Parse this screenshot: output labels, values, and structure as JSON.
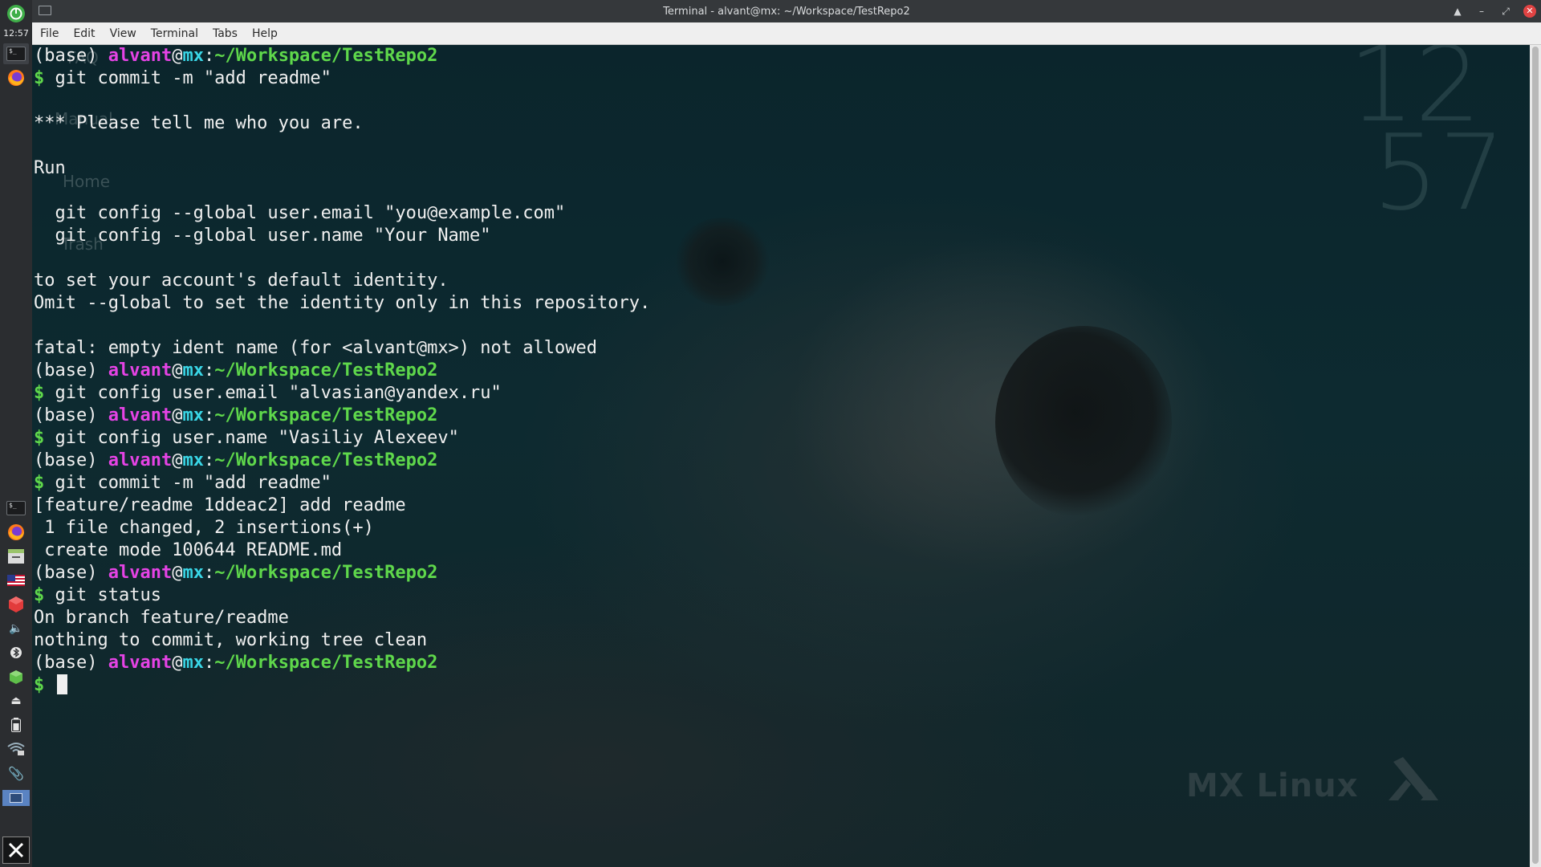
{
  "window": {
    "title": "Terminal - alvant@mx: ~/Workspace/TestRepo2"
  },
  "menubar": {
    "items": [
      "File",
      "Edit",
      "View",
      "Terminal",
      "Tabs",
      "Help"
    ]
  },
  "panel": {
    "clock": "12:57"
  },
  "desktop": {
    "clock_hours": "12",
    "clock_minutes": "57",
    "icon_labels": [
      "FAQ",
      "Manual",
      "Home",
      "Trash"
    ],
    "brand": "MX Linux"
  },
  "prompt": {
    "env": "(base)",
    "user": "alvant",
    "at": "@",
    "host": "mx",
    "colon": ":",
    "path": "~/Workspace/TestRepo2",
    "dollar": "$"
  },
  "terminal": {
    "lines": [
      {
        "type": "prompt"
      },
      {
        "type": "cmd",
        "text": "git commit -m \"add readme\""
      },
      {
        "type": "out",
        "text": ""
      },
      {
        "type": "out",
        "text": "*** Please tell me who you are."
      },
      {
        "type": "out",
        "text": ""
      },
      {
        "type": "out",
        "text": "Run"
      },
      {
        "type": "out",
        "text": ""
      },
      {
        "type": "out",
        "text": "  git config --global user.email \"you@example.com\""
      },
      {
        "type": "out",
        "text": "  git config --global user.name \"Your Name\""
      },
      {
        "type": "out",
        "text": ""
      },
      {
        "type": "out",
        "text": "to set your account's default identity."
      },
      {
        "type": "out",
        "text": "Omit --global to set the identity only in this repository."
      },
      {
        "type": "out",
        "text": ""
      },
      {
        "type": "out",
        "text": "fatal: empty ident name (for <alvant@mx>) not allowed"
      },
      {
        "type": "prompt"
      },
      {
        "type": "cmd",
        "text": "git config user.email \"alvasian@yandex.ru\""
      },
      {
        "type": "prompt"
      },
      {
        "type": "cmd",
        "text": "git config user.name \"Vasiliy Alexeev\""
      },
      {
        "type": "prompt"
      },
      {
        "type": "cmd",
        "text": "git commit -m \"add readme\""
      },
      {
        "type": "out",
        "text": "[feature/readme 1ddeac2] add readme"
      },
      {
        "type": "out",
        "text": " 1 file changed, 2 insertions(+)"
      },
      {
        "type": "out",
        "text": " create mode 100644 README.md"
      },
      {
        "type": "prompt"
      },
      {
        "type": "cmd",
        "text": "git status"
      },
      {
        "type": "out",
        "text": "On branch feature/readme"
      },
      {
        "type": "out",
        "text": "nothing to commit, working tree clean"
      },
      {
        "type": "prompt"
      },
      {
        "type": "input",
        "text": ""
      }
    ]
  },
  "colors": {
    "user": "#e543e5",
    "host": "#39d6e6",
    "path": "#5fd84b",
    "close_button": "#e04343"
  }
}
